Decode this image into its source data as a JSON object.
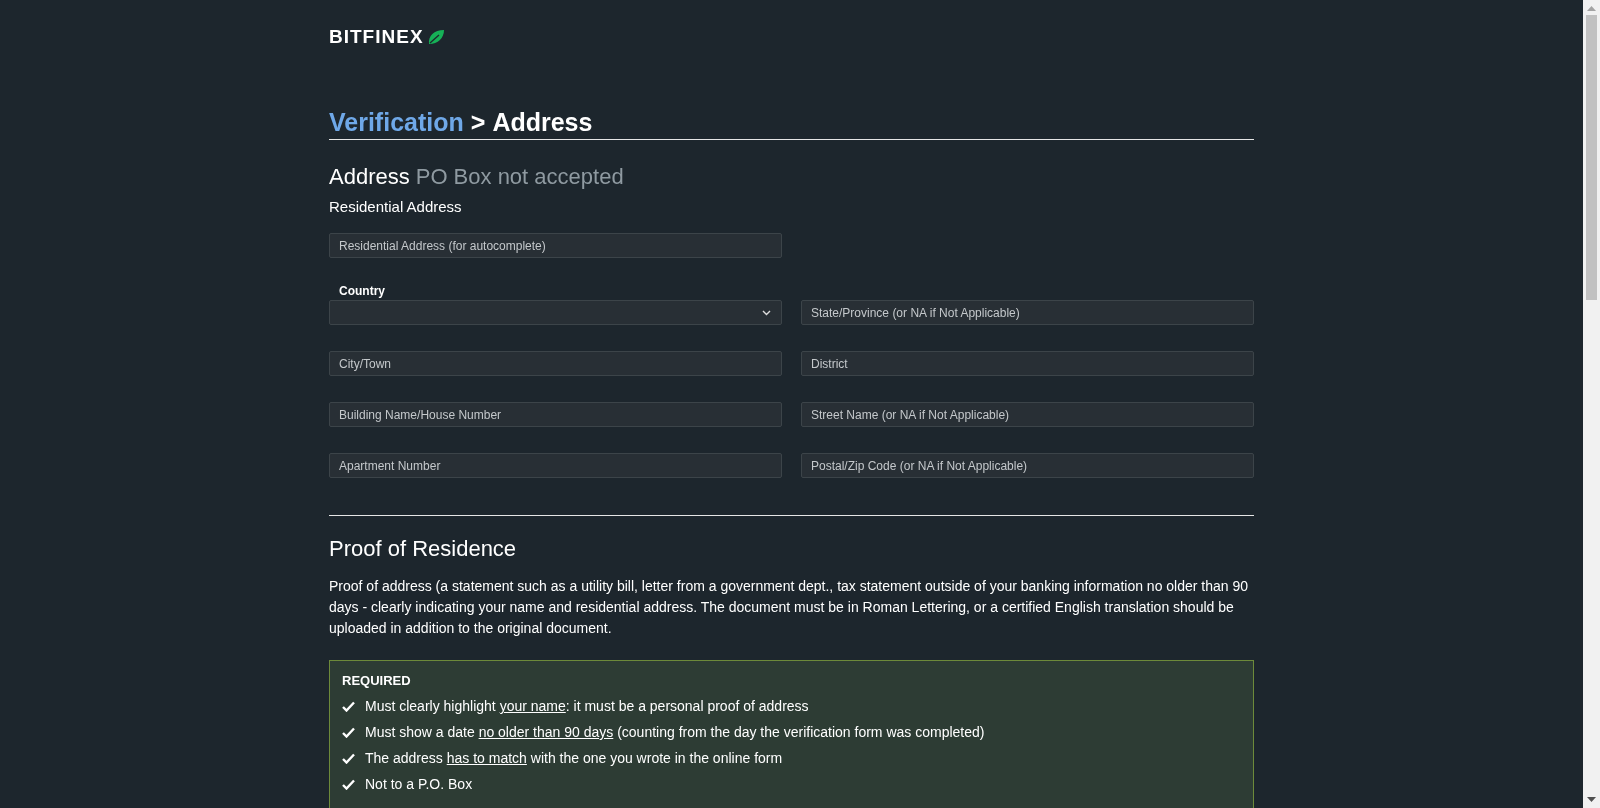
{
  "logo": {
    "text": "BITFINEX"
  },
  "breadcrumb": {
    "parent": "Verification",
    "separator": ">",
    "current": "Address"
  },
  "address_section": {
    "title": "Address",
    "note": "PO Box not accepted",
    "subtitle": "Residential Address"
  },
  "fields": [
    {
      "kind": "text",
      "placeholder": "Residential Address (for autocomplete)"
    },
    {
      "kind": "spacer"
    },
    {
      "kind": "select",
      "label": "Country"
    },
    {
      "kind": "text",
      "placeholder": "State/Province (or NA if Not Applicable)"
    },
    {
      "kind": "text",
      "placeholder": "City/Town"
    },
    {
      "kind": "text",
      "placeholder": "District"
    },
    {
      "kind": "text",
      "placeholder": "Building Name/House Number"
    },
    {
      "kind": "text",
      "placeholder": "Street Name (or NA if Not Applicable)"
    },
    {
      "kind": "text",
      "placeholder": "Apartment Number"
    },
    {
      "kind": "text",
      "placeholder": "Postal/Zip Code (or NA if Not Applicable)"
    }
  ],
  "proof_section": {
    "title": "Proof of Residence",
    "description": "Proof of address (a statement such as a utility bill, letter from a government dept., tax statement outside of your banking information no older than 90 days - clearly indicating your name and residential address. The document must be in Roman Lettering, or a certified English translation should be uploaded in addition to the original document."
  },
  "required_box": {
    "title": "REQUIRED",
    "items": [
      {
        "before": "Must clearly highlight ",
        "underlined": "your name",
        "after": ": it must be a personal proof of address"
      },
      {
        "before": "Must show a date ",
        "underlined": "no older than 90 days",
        "after": " (counting from the day the verification form was completed)"
      },
      {
        "before": "The address ",
        "underlined": "has to match",
        "after": " with the one you wrote in the online form"
      },
      {
        "before": "Not to a P.O. Box"
      }
    ]
  }
}
